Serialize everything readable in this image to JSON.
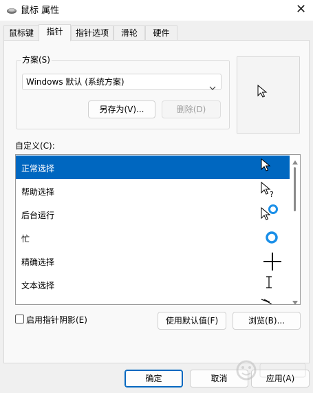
{
  "window": {
    "title": "鼠标 属性",
    "close_glyph": "✕",
    "icon": "mouse-icon"
  },
  "tabs": [
    {
      "label": "鼠标键",
      "active": false
    },
    {
      "label": "指针",
      "active": true
    },
    {
      "label": "指针选项",
      "active": false
    },
    {
      "label": "滑轮",
      "active": false
    },
    {
      "label": "硬件",
      "active": false
    }
  ],
  "scheme": {
    "group_label": "方案(S)",
    "selected": "Windows 默认 (系统方案)",
    "save_as_label": "另存为(V)...",
    "delete_label": "删除(D)"
  },
  "custom": {
    "label": "自定义(C):",
    "items": [
      {
        "label": "正常选择",
        "cursor": "arrow-cursor",
        "selected": true
      },
      {
        "label": "帮助选择",
        "cursor": "help-cursor",
        "selected": false
      },
      {
        "label": "后台运行",
        "cursor": "working-in-background-cursor",
        "selected": false
      },
      {
        "label": "忙",
        "cursor": "busy-cursor",
        "selected": false
      },
      {
        "label": "精确选择",
        "cursor": "crosshair-cursor",
        "selected": false
      },
      {
        "label": "文本选择",
        "cursor": "text-beam-cursor",
        "selected": false
      },
      {
        "label": "",
        "cursor": "handwriting-cursor",
        "selected": false
      }
    ]
  },
  "options": {
    "shadow_label": "启用指针阴影(E)",
    "shadow_checked": false,
    "use_default_label": "使用默认值(F)",
    "browse_label": "浏览(B)..."
  },
  "footer": {
    "ok_label": "确定",
    "cancel_label": "取消",
    "apply_label": "应用(A)"
  },
  "colors": {
    "accent": "#0067c0",
    "busy_ring": "#1a8fe8"
  }
}
